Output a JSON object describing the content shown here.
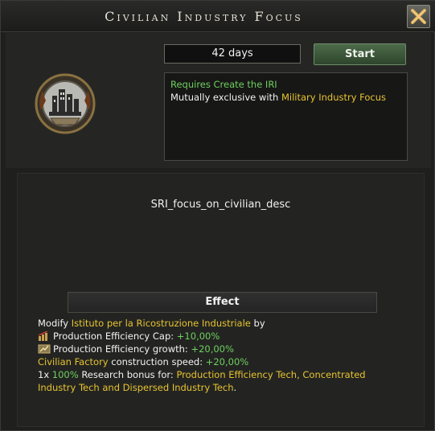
{
  "window": {
    "title": "Civilian Industry Focus"
  },
  "focus": {
    "duration": "42 days",
    "start_label": "Start",
    "icon": "civilian-industry-focus-icon"
  },
  "requirements": {
    "requires_prefix": "Requires ",
    "requires_value": "Create the IRI",
    "exclusive_prefix": "Mutually exclusive with ",
    "exclusive_value": "Military Industry Focus"
  },
  "description": "SRI_focus_on_civilian_desc",
  "effect": {
    "header": "Effect",
    "line1_prefix": "Modify ",
    "line1_target": "Istituto per la Ricostruzione Industriale",
    "line1_suffix": " by",
    "line2_label": "Production Efficiency Cap: ",
    "line2_value": "+10,00%",
    "line3_label": "Production Efficiency growth: ",
    "line3_value": "+20,00%",
    "line4_subject": "Civilian Factory",
    "line4_label": " construction speed: ",
    "line4_value": "+20,00%",
    "line5_count": "1x ",
    "line5_percent": "100%",
    "line5_label": " Research bonus for: ",
    "line5_techs": "Production Efficiency Tech, Concentrated",
    "line6_techs": "Industry Tech and Dispersed Industry Tech",
    "line6_end": "."
  },
  "colors": {
    "positive": "#6fcf5f",
    "highlight": "#e8c32f",
    "start_button": "#3d5a3a"
  }
}
